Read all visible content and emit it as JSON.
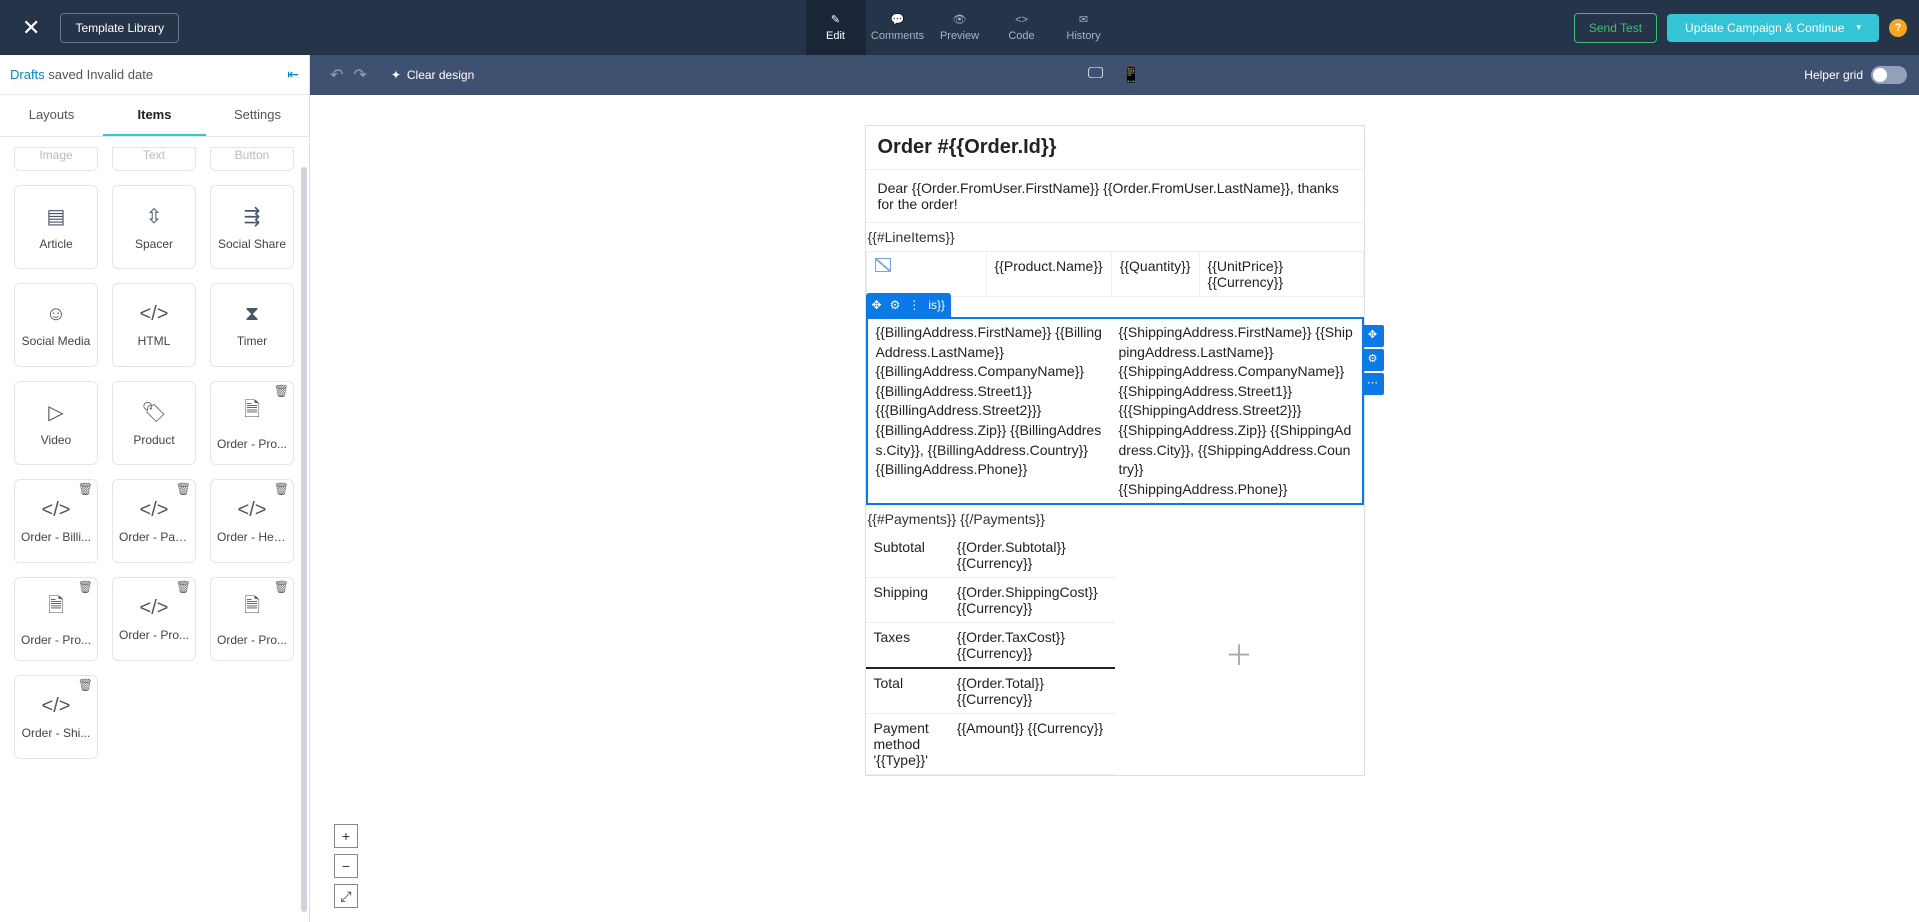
{
  "topbar": {
    "template_library": "Template Library",
    "tabs": {
      "edit": "Edit",
      "comments": "Comments",
      "preview": "Preview",
      "code": "Code",
      "history": "History"
    },
    "send_test": "Send Test",
    "update_campaign": "Update Campaign & Continue"
  },
  "secondbar": {
    "clear_design": "Clear design",
    "helper_grid": "Helper grid"
  },
  "sidebar": {
    "drafts_link": "Drafts",
    "drafts_saved": " saved Invalid date",
    "tabs": {
      "layouts": "Layouts",
      "items": "Items",
      "settings": "Settings"
    },
    "items_row0": {
      "image": "Image",
      "text": "Text",
      "button": "Button"
    },
    "items": {
      "article": "Article",
      "spacer": "Spacer",
      "social_share": "Social Share",
      "social_media": "Social Media",
      "html": "HTML",
      "timer": "Timer",
      "video": "Video",
      "product": "Product",
      "order_pro": "Order - Pro...",
      "order_billi": "Order - Billi...",
      "order_pay": "Order - Pay...",
      "order_hea": "Order - Hea...",
      "order_pro2": "Order - Pro...",
      "order_pro3": "Order - Pro...",
      "order_pro4": "Order - Pro...",
      "order_shi": "Order - Shi..."
    }
  },
  "email": {
    "title": "Order #{{Order.Id}}",
    "greeting": "Dear {{Order.FromUser.FirstName}} {{Order.FromUser.LastName}}, thanks for the order!",
    "line_items_open": "{{#LineItems}}",
    "product_name": "{{Product.Name}}",
    "quantity": "{{Quantity}}",
    "unit_price": "{{UnitPrice}} {{Currency}}",
    "sel_tail": "is}}",
    "billing": "{{BillingAddress.FirstName}} {{BillingAddress.LastName}}\n{{BillingAddress.CompanyName}}\n{{BillingAddress.Street1}}\n{{{BillingAddress.Street2}}}\n{{BillingAddress.Zip}} {{BillingAddress.City}}, {{BillingAddress.Country}}\n{{BillingAddress.Phone}}",
    "shipping": "{{ShippingAddress.FirstName}} {{ShippingAddress.LastName}}\n{{ShippingAddress.CompanyName}}\n{{ShippingAddress.Street1}}\n{{{ShippingAddress.Street2}}}\n{{ShippingAddress.Zip}} {{ShippingAddress.City}}, {{ShippingAddress.Country}}\n{{ShippingAddress.Phone}}",
    "payments_loop": "{{#Payments}} {{/Payments}}",
    "totals": {
      "subtotal_label": "Subtotal",
      "subtotal_val": "{{Order.Subtotal}} {{Currency}}",
      "shipping_label": "Shipping",
      "shipping_val": "{{Order.ShippingCost}} {{Currency}}",
      "taxes_label": "Taxes",
      "taxes_val": "{{Order.TaxCost}} {{Currency}}",
      "total_label": "Total",
      "total_val": "{{Order.Total}} {{Currency}}",
      "pm_label": "Payment method '{{Type}}'",
      "pm_val": "{{Amount}} {{Currency}}"
    }
  }
}
